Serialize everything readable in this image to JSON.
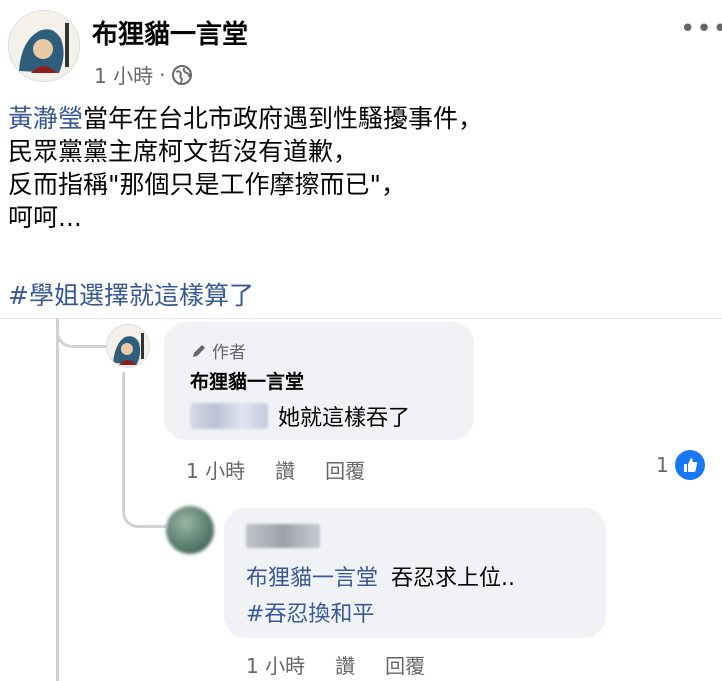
{
  "post": {
    "page_name": "布狸貓一言堂",
    "time": "1 小時",
    "separator": "·",
    "privacy_icon": "globe-icon",
    "more_icon": "more-icon",
    "more_label": "•••",
    "mention": "黃瀞瑩",
    "text_line1_rest": "當年在台北市政府遇到性騷擾事件，",
    "text_line2": "民眾黨黨主席柯文哲沒有道歉，",
    "text_line3": "反而指稱\"那個只是工作摩擦而已\"，",
    "text_line4": "呵呵...",
    "hashtag": "#學姐選擇就這樣算了"
  },
  "comments": [
    {
      "author_badge": "作者",
      "author_badge_icon": "pencil-icon",
      "name": "布狸貓一言堂",
      "text": "她就這樣吞了",
      "time": "1 小時",
      "like_label": "讚",
      "reply_label": "回覆",
      "reaction_count": "1",
      "reaction_icon": "like-icon"
    },
    {
      "mention": "布狸貓一言堂",
      "text_rest": "吞忍求上位..",
      "hashtag": "#吞忍換和平",
      "time": "1 小時",
      "like_label": "讚",
      "reply_label": "回覆"
    }
  ],
  "colors": {
    "link": "#385898",
    "muted": "#65676b",
    "bubble": "#f0f2f5",
    "like_blue": "#1877f2"
  }
}
